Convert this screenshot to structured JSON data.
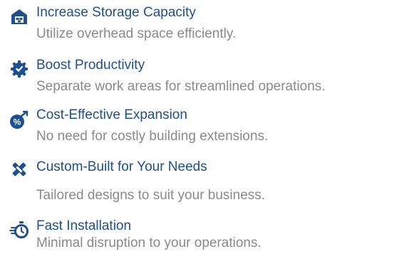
{
  "colors": {
    "accent": "#1d4f91",
    "muted_text": "#8a8a8a"
  },
  "features": [
    {
      "icon": "warehouse-icon",
      "title": "Increase Storage Capacity",
      "description": "Utilize overhead space efficiently."
    },
    {
      "icon": "gear-icon",
      "title": "Boost Productivity",
      "description": "Separate work areas for streamlined operations."
    },
    {
      "icon": "savings-icon",
      "title": "Cost-Effective Expansion",
      "description": "No need for costly building extensions."
    },
    {
      "icon": "tools-icon",
      "title": "Custom-Built for Your Needs",
      "description": "Tailored designs to suit your business."
    },
    {
      "icon": "stopwatch-icon",
      "title": "Fast Installation",
      "description": "Minimal disruption to your operations."
    }
  ]
}
